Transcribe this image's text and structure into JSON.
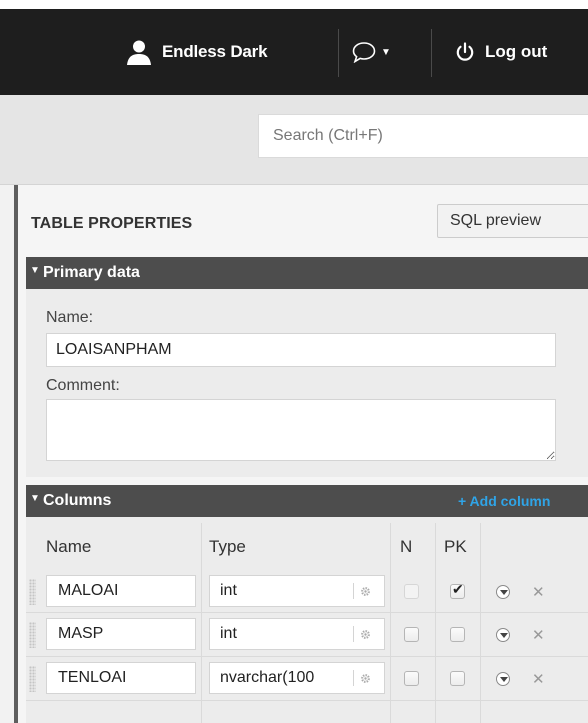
{
  "header": {
    "user_name": "Endless Dark",
    "logout_label": "Log out",
    "user_icon": "user-icon",
    "chat_icon": "chat-bubble-icon",
    "logout_icon": "power-icon"
  },
  "search": {
    "placeholder": "Search (Ctrl+F)"
  },
  "panel": {
    "title": "TABLE PROPERTIES",
    "sql_preview_label": "SQL preview"
  },
  "primary_data": {
    "header": "Primary data",
    "name_label": "Name:",
    "name_value": "LOAISANPHAM",
    "comment_label": "Comment:",
    "comment_value": ""
  },
  "columns": {
    "header": "Columns",
    "add_label": "+ Add column",
    "headers": {
      "name": "Name",
      "type": "Type",
      "n": "N",
      "pk": "PK"
    },
    "rows": [
      {
        "name": "MALOAI",
        "type": "int",
        "nullable": false,
        "pk": true,
        "nullable_disabled": true
      },
      {
        "name": "MASP",
        "type": "int",
        "nullable": false,
        "pk": false,
        "nullable_disabled": false
      },
      {
        "name": "TENLOAI",
        "type": "nvarchar(100",
        "nullable": false,
        "pk": false,
        "nullable_disabled": false
      }
    ]
  },
  "colors": {
    "topbar_bg": "#1e1e1e",
    "section_header_bg": "#4d4d4d",
    "accent": "#2fa4e7"
  }
}
